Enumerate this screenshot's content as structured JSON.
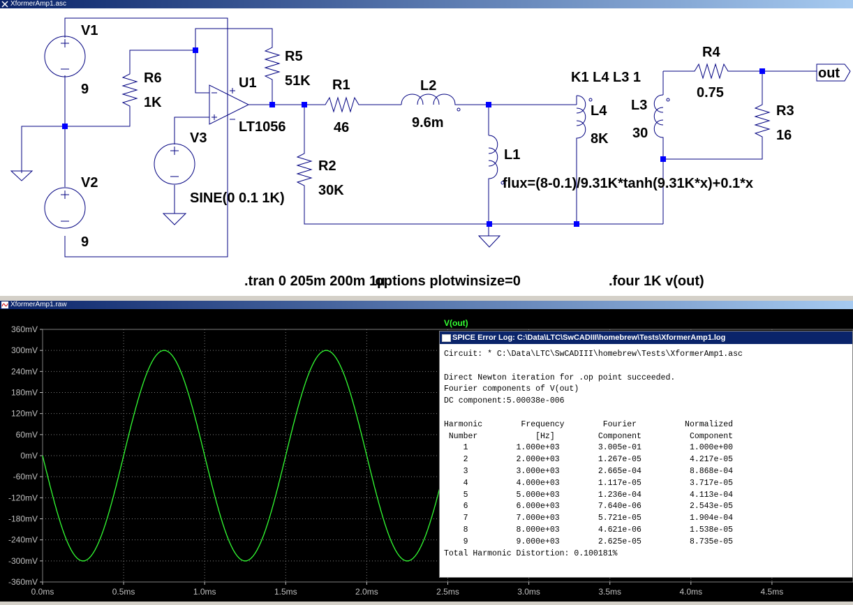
{
  "schematic_window": {
    "title": "XformerAmp1.asc",
    "components": {
      "v1": {
        "name": "V1",
        "value": "9"
      },
      "v2": {
        "name": "V2",
        "value": "9"
      },
      "v3": {
        "name": "V3",
        "value": "SINE(0 0.1 1K)"
      },
      "r6": {
        "name": "R6",
        "value": "1K"
      },
      "r5": {
        "name": "R5",
        "value": "51K"
      },
      "u1": {
        "name": "U1",
        "value": "LT1056"
      },
      "r1": {
        "name": "R1",
        "value": "46"
      },
      "l2": {
        "name": "L2",
        "value": "9.6m"
      },
      "r2": {
        "name": "R2",
        "value": "30K"
      },
      "l1": {
        "name": "L1",
        "value": "flux=(8-0.1)/9.31K*tanh(9.31K*x)+0.1*x"
      },
      "l4": {
        "name": "L4",
        "value": "8K"
      },
      "l3": {
        "name": "L3",
        "value": "30"
      },
      "r4": {
        "name": "R4",
        "value": "0.75"
      },
      "r3": {
        "name": "R3",
        "value": "16"
      }
    },
    "k_statement": "K1 L4 L3 1",
    "out_label": "out",
    "directive_tran": ".tran 0 205m 200m 1µ",
    "directive_options": ".options plotwinsize=0",
    "directive_four": ".four 1K v(out)"
  },
  "waveform_window": {
    "title": "XformerAmp1.raw",
    "trace_name": "V(out)",
    "trace_color": "#33ff33",
    "background": "#000000",
    "y_ticks": [
      "360mV",
      "300mV",
      "240mV",
      "180mV",
      "120mV",
      "60mV",
      "0mV",
      "-60mV",
      "-120mV",
      "-180mV",
      "-240mV",
      "-300mV",
      "-360mV"
    ],
    "x_ticks": [
      "0.0ms",
      "0.5ms",
      "1.0ms",
      "1.5ms",
      "2.0ms",
      "2.5ms",
      "3.0ms",
      "3.5ms",
      "4.0ms",
      "4.5ms"
    ],
    "chart_data": {
      "type": "line",
      "series": [
        {
          "name": "V(out)",
          "amplitude_mV": 300,
          "frequency_Hz": 1000,
          "phase": "inverted",
          "x_range_ms": [
            0,
            5
          ]
        }
      ],
      "xlim": [
        0,
        5
      ],
      "ylim": [
        -360,
        360
      ],
      "grid": true
    }
  },
  "error_log": {
    "title": "SPICE Error Log: C:\\Data\\LTC\\SwCADIII\\homebrew\\Tests\\XformerAmp1.log",
    "lines": [
      "Circuit: * C:\\Data\\LTC\\SwCADIII\\homebrew\\Tests\\XformerAmp1.asc",
      "",
      "Direct Newton iteration for .op point succeeded.",
      "Fourier components of V(out)",
      "DC component:5.00038e-006",
      "",
      "Harmonic        Frequency        Fourier          Normalized",
      " Number            [Hz]         Component          Component",
      "    1          1.000e+03        3.005e-01          1.000e+00",
      "    2          2.000e+03        1.267e-05          4.217e-05",
      "    3          3.000e+03        2.665e-04          8.868e-04",
      "    4          4.000e+03        1.117e-05          3.717e-05",
      "    5          5.000e+03        1.236e-04          4.113e-04",
      "    6          6.000e+03        7.640e-06          2.543e-05",
      "    7          7.000e+03        5.721e-05          1.904e-04",
      "    8          8.000e+03        4.621e-06          1.538e-05",
      "    9          9.000e+03        2.625e-05          8.735e-05",
      "Total Harmonic Distortion: 0.100181%"
    ]
  }
}
